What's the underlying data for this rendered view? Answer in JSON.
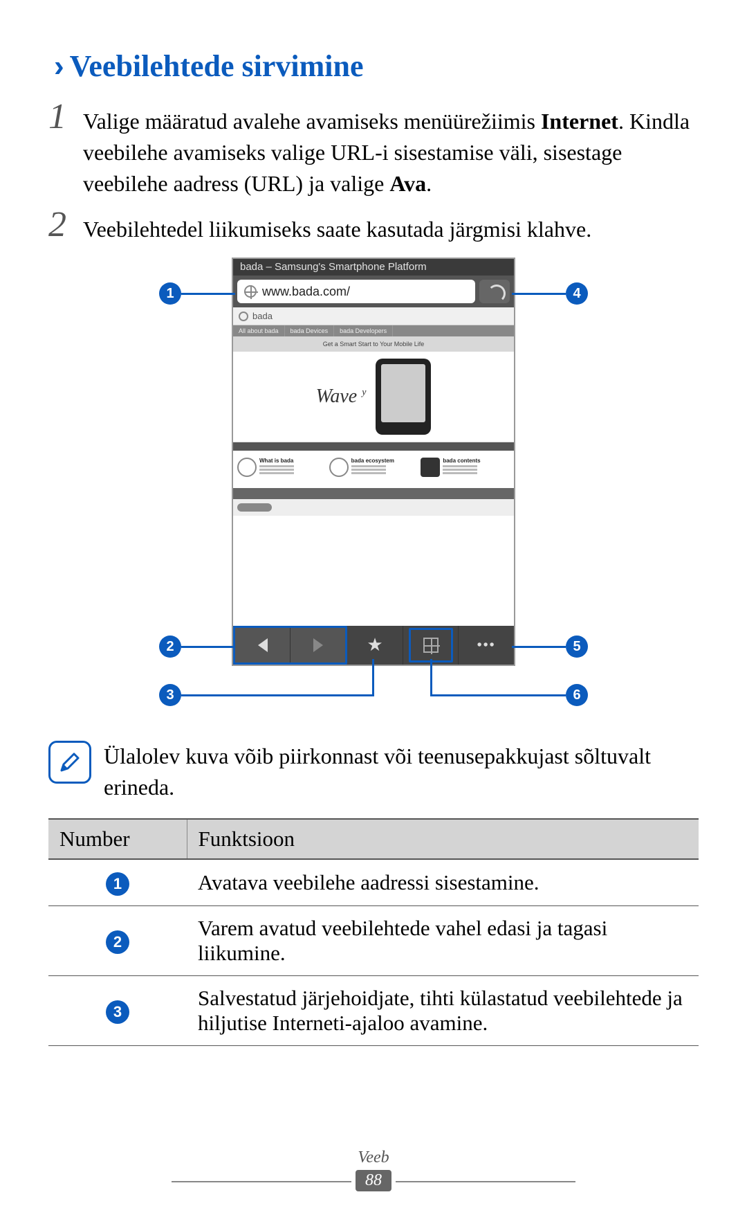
{
  "heading": "Veebilehtede sirvimine",
  "steps": {
    "s1": {
      "num": "1",
      "line1_a": "Valige määratud avalehe avamiseks menüürežiimis ",
      "line1_b": "Internet",
      "line1_c": ".",
      "line2": "Kindla veebilehe avamiseks valige URL-i sisestamise väli, sisestage veebilehe aadress (URL) ja valige ",
      "line2_b": "Ava",
      "line2_c": "."
    },
    "s2": {
      "num": "2",
      "text": "Veebilehtedel liikumiseks saate kasutada järgmisi klahve."
    }
  },
  "screenshot": {
    "title": "bada – Samsung's Smartphone Platform",
    "url": "www.bada.com/",
    "brand": "bada",
    "hero_caption": "Get a Smart Start to Your Mobile Life",
    "wave": "Wave",
    "wave_sub": "y",
    "features": {
      "f1": "What is bada",
      "f2": "bada ecosystem",
      "f3": "bada contents"
    }
  },
  "callouts": {
    "c1": "1",
    "c2": "2",
    "c3": "3",
    "c4": "4",
    "c5": "5",
    "c6": "6"
  },
  "note": "Ülalolev kuva võib piirkonnast või teenusepakkujast sõltuvalt erineda.",
  "table": {
    "h1": "Number",
    "h2": "Funktsioon",
    "rows": {
      "r1": {
        "n": "1",
        "f": "Avatava veebilehe aadressi sisestamine."
      },
      "r2": {
        "n": "2",
        "f": "Varem avatud veebilehtede vahel edasi ja tagasi liikumine."
      },
      "r3": {
        "n": "3",
        "f": "Salvestatud järjehoidjate, tihti külastatud veebilehtede ja hiljutise Interneti-ajaloo avamine."
      }
    }
  },
  "footer": {
    "section": "Veeb",
    "page": "88"
  }
}
